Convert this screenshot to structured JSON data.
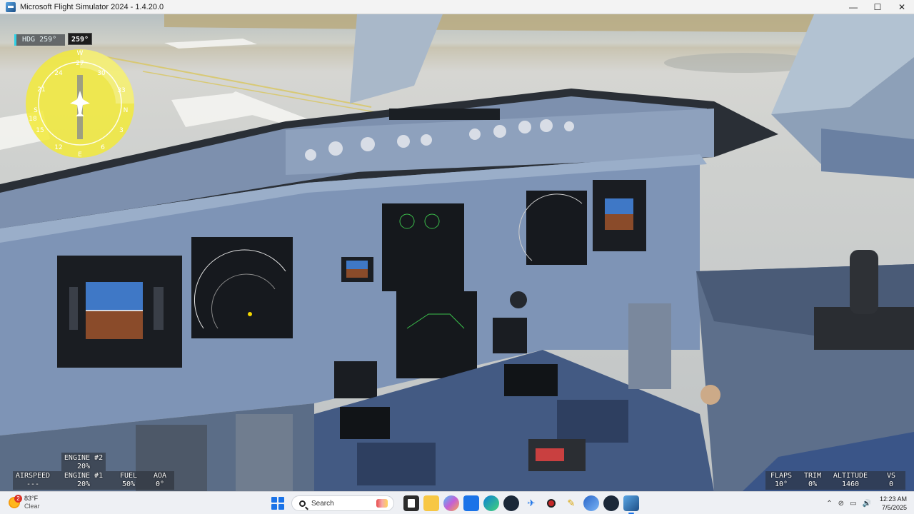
{
  "window": {
    "title": "Microsoft Flight Simulator 2024 - 1.4.20.0",
    "controls": {
      "minimize": "—",
      "maximize": "☐",
      "close": "✕"
    }
  },
  "hud": {
    "heading_indicator": {
      "label": "HDG",
      "value": "259°"
    },
    "heading_bug": "259°",
    "compass": {
      "labels": [
        "21",
        "24",
        "27",
        "30",
        "33",
        "N",
        "S",
        "E",
        "W",
        "3",
        "6",
        "12",
        "15",
        "18"
      ]
    },
    "stats": {
      "airspeed": {
        "label": "AIRSPEED",
        "value": "---"
      },
      "engine2": {
        "label": "ENGINE #2",
        "value": "20%"
      },
      "engine1": {
        "label": "ENGINE #1",
        "value": "20%"
      },
      "fuel": {
        "label": "FUEL",
        "value": "50%"
      },
      "aoa": {
        "label": "AOA",
        "value": "0°"
      },
      "flaps": {
        "label": "FLAPS",
        "value": "10°"
      },
      "trim": {
        "label": "TRIM",
        "value": "0%"
      },
      "altitude": {
        "label": "ALTITUDE",
        "value": "1460"
      },
      "vs": {
        "label": "VS",
        "value": "0"
      }
    }
  },
  "taskbar": {
    "weather": {
      "temp": "83°F",
      "condition": "Clear",
      "badge": "2"
    },
    "search_placeholder": "Search",
    "apps": [
      "file-explorer-icon",
      "copilot-icon",
      "store-icon",
      "edge-icon",
      "steam-icon",
      "flight-sim-icon",
      "record-icon",
      "pen-icon",
      "edge-beta-icon",
      "steam-2-icon",
      "msfs-icon"
    ],
    "clock": {
      "time": "12:23 AM",
      "date": "7/5/2025"
    }
  },
  "colors": {
    "hdg_accent": "#2fd1e6",
    "compass_yellow": "#f2ea3a",
    "panel_blue": "#7f93b3",
    "taskbar_accent": "#1a73e8"
  }
}
